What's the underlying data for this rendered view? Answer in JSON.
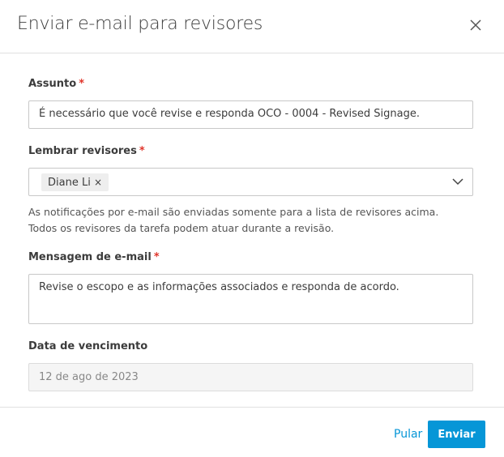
{
  "dialog": {
    "title": "Enviar e-mail para revisores"
  },
  "subject": {
    "label": "Assunto",
    "required": "*",
    "value": "É necessário que você revise e responda OCO - 0004 - Revised Signage."
  },
  "reviewers": {
    "label": "Lembrar revisores",
    "required": "*",
    "chips": [
      {
        "name": "Diane Li",
        "remove": "×"
      }
    ],
    "help_line1": "As notificações por e-mail são enviadas somente para a lista de revisores acima.",
    "help_line2": "Todos os revisores da tarefa podem atuar durante a revisão."
  },
  "message": {
    "label": "Mensagem de e-mail",
    "required": "*",
    "value": "Revise o escopo e as informações associados e responda de acordo."
  },
  "due_date": {
    "label": "Data de vencimento",
    "value": "12 de ago de 2023"
  },
  "footer": {
    "skip": "Pular",
    "send": "Enviar"
  },
  "colors": {
    "accent": "#0696d7",
    "required": "#e0352b"
  }
}
